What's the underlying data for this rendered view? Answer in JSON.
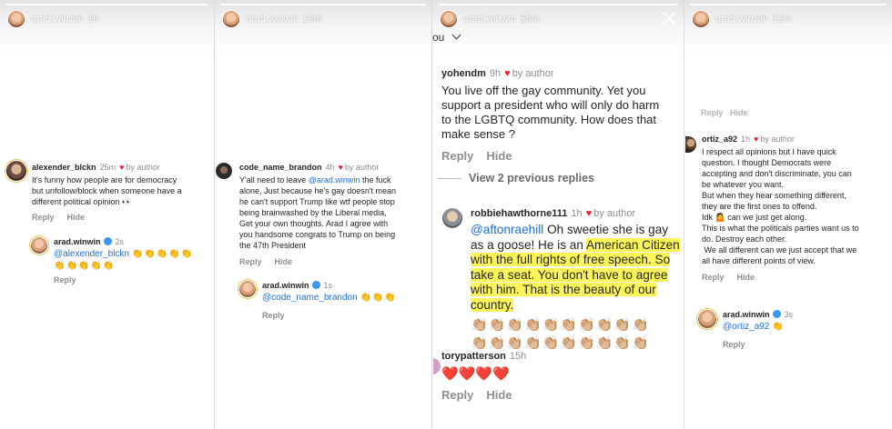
{
  "colors": {
    "heart": "#ed1c3c",
    "mention": "#1d6fd8",
    "highlight": "#fcf55a",
    "verified": "#3897f0"
  },
  "panel1": {
    "header": {
      "username": "arad.winwin",
      "time": "1h"
    },
    "comment": {
      "username": "alexender_blckn",
      "time": "25m",
      "by_author": "by author",
      "lines": [
        "It's funny how people are for democracy",
        "but unfollow/block when someone have a",
        "different political opinion 👀"
      ],
      "reply": "Reply",
      "hide": "Hide"
    },
    "reply": {
      "username": "arad.winwin",
      "time": "2s",
      "mention": "@alexender_blckn",
      "claps1": "👏👏👏👏👏",
      "claps2": "👏👏👏👏👏",
      "reply": "Reply"
    }
  },
  "panel2": {
    "header": {
      "username": "arad.winwin",
      "time": "13m"
    },
    "comment": {
      "username": "code_name_brandon",
      "time": "4h",
      "by_author": "by author",
      "l1_a": "Y'all need to leave ",
      "l1_mention": "@arad.winwin",
      "l1_b": " the fuck",
      "lines": [
        "alone, Just because he's gay doesn't mean",
        "he can't support Trump like wtf people stop",
        "being brainwashed by the Liberal media,",
        "Get your own thoughts. Arad I agree with",
        "you handsome congrats to Trump on being",
        "the 47th President"
      ],
      "reply": "Reply",
      "hide": "Hide"
    },
    "reply": {
      "username": "arad.winwin",
      "time": "1s",
      "mention": "@code_name_brandon",
      "claps": "👏👏👏",
      "reply": "Reply"
    }
  },
  "panel3": {
    "header": {
      "username": "arad.winwin",
      "time": "36m"
    },
    "partial_top": "ou",
    "comment1": {
      "username": "yohendm",
      "time": "9h",
      "by_author": "by author",
      "lines": [
        "You live off the gay community. Yet you",
        "support a president who will only do harm",
        "to the LGBTQ community.  How does that",
        "make sense ?"
      ],
      "reply": "Reply",
      "hide": "Hide"
    },
    "view_previous": "View 2 previous replies",
    "comment2": {
      "username": "robbiehawthorne111",
      "time": "1h",
      "by_author": "by author",
      "l1_mention": "@aftonraehill",
      "l1_b": "  Oh sweetie she is gay",
      "l2": "as a goose! He is an ",
      "l2_hl": "American Citizen",
      "l3_hl": "with the full rights of free speech. So",
      "l4_hl": "take a seat. You don't have to agree",
      "l5_hl": "with him. That is the beauty of our",
      "l6_hl": "country.",
      "claps1": "👏🏼👏🏼👏🏼👏🏼👏🏼👏🏼👏🏼👏🏼👏🏼👏🏼",
      "claps2": "👏🏼👏🏼👏🏼👏🏼👏🏼👏🏼👏🏼👏🏼👏🏼👏🏼"
    },
    "comment3": {
      "username": "torypatterson",
      "time": "15h",
      "hearts": "❤️❤️❤️❤️",
      "reply": "Reply",
      "hide": "Hide"
    }
  },
  "panel4": {
    "header": {
      "username": "arad.winwin",
      "time": "12m"
    },
    "partial_top": "Reply   Hide",
    "comment": {
      "username": "ortiz_a92",
      "time": "1h",
      "by_author": "by author",
      "lines": [
        "I respect all opinions but I have quick",
        "question. I thought Democrats were",
        "accepting and don't discriminate, you can",
        "be whatever you want.",
        "But when they hear something different,",
        "they are the first ones to offend.",
        "Idk 🤷 can we just get along.",
        "This is what the politicals parties want us to",
        "do. Destroy each other.",
        " We all different can we just accept that we",
        "all have different points of view."
      ],
      "reply": "Reply",
      "hide": "Hide"
    },
    "reply": {
      "username": "arad.winwin",
      "time": "3s",
      "mention": "@ortiz_a92",
      "claps": "👏",
      "reply": "Reply"
    }
  }
}
